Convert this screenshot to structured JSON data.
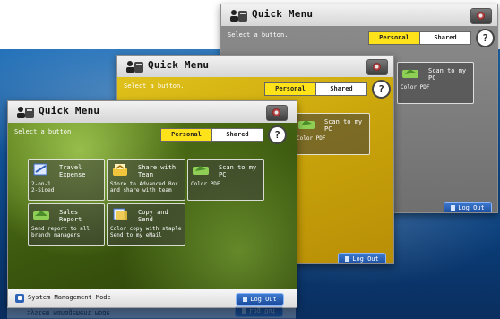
{
  "app": {
    "title": "Quick Menu",
    "instruction": "Select a button.",
    "tabs": {
      "personal": "Personal",
      "shared": "Shared"
    },
    "help_label": "?",
    "logout_label": "Log Out",
    "system_mode_label": "System Management Mode"
  },
  "tiles": [
    {
      "title": "Travel Expense",
      "desc": "2-on-1\n2-Sided"
    },
    {
      "title": "Share with Team",
      "desc": "Store to Advanced Box and share with team"
    },
    {
      "title": "Scan to my PC",
      "desc": "Color PDF"
    },
    {
      "title": "Sales Report",
      "desc": "Send report to all branch managers"
    },
    {
      "title": "Copy and Send",
      "desc": "Color copy with staple Send to my eMail"
    }
  ],
  "colors": {
    "personal_tab": "#ffe31a",
    "logout_button": "#2b63b8",
    "mid_window_bg": "#caa50b",
    "back_window_bg": "#7a7a7a",
    "front_window_bg": "#3d5a0f"
  },
  "icons": [
    "quick-menu-icon",
    "settings-icon",
    "help-icon",
    "scan-icon",
    "travel-icon",
    "share-icon",
    "copy-icon",
    "system-icon",
    "logout-icon"
  ]
}
